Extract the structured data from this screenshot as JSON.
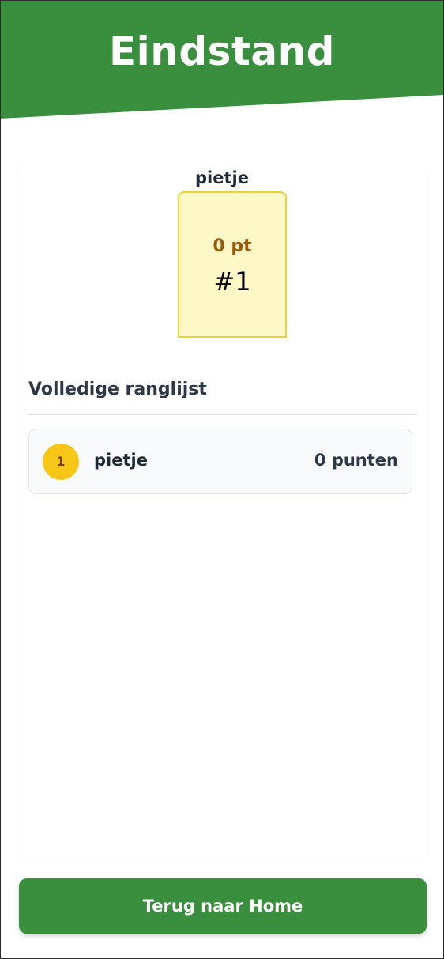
{
  "header": {
    "title": "Eindstand"
  },
  "podium": {
    "first": {
      "name": "pietje",
      "points": "0 pt",
      "rank": "#1"
    }
  },
  "ranking": {
    "title": "Volledige ranglijst",
    "entries": [
      {
        "rank": "1",
        "name": "pietje",
        "score": "0 punten"
      }
    ]
  },
  "actions": {
    "home_label": "Terug naar Home"
  },
  "colors": {
    "primary_green": "#3a8f3e",
    "podium_fill": "#fef8c7",
    "podium_border": "#f2cf2a",
    "gold_badge": "#f8c616",
    "points_text": "#9b5a0b"
  }
}
